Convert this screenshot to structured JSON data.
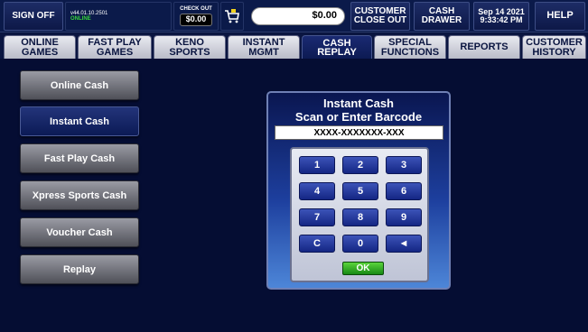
{
  "topbar": {
    "sign_off": "SIGN OFF",
    "version": "v44.01.10.2501",
    "status": "ONLINE",
    "checkout_label": "CHECK OUT",
    "checkout_amount": "$0.00",
    "balance": "$0.00",
    "customer_closeout": "CUSTOMER CLOSE OUT",
    "cash_drawer": "CASH DRAWER",
    "date": "Sep 14 2021",
    "time": "9:33:42 PM",
    "help": "HELP"
  },
  "tabs": [
    {
      "line1": "ONLINE",
      "line2": "GAMES"
    },
    {
      "line1": "FAST PLAY",
      "line2": "GAMES"
    },
    {
      "line1": "KENO",
      "line2": "SPORTS"
    },
    {
      "line1": "INSTANT",
      "line2": "MGMT"
    },
    {
      "line1": "CASH",
      "line2": "REPLAY"
    },
    {
      "line1": "SPECIAL",
      "line2": "FUNCTIONS"
    },
    {
      "line1": "REPORTS",
      "line2": ""
    },
    {
      "line1": "CUSTOMER",
      "line2": "HISTORY"
    }
  ],
  "sidebar": {
    "items": [
      {
        "label": "Online Cash"
      },
      {
        "label": "Instant Cash"
      },
      {
        "label": "Fast Play Cash"
      },
      {
        "label": "Xpress Sports Cash"
      },
      {
        "label": "Voucher Cash"
      },
      {
        "label": "Replay"
      }
    ]
  },
  "dialog": {
    "title_line1": "Instant Cash",
    "title_line2": "Scan or Enter Barcode",
    "barcode_placeholder": "XXXX-XXXXXXX-XXX",
    "keys": [
      "1",
      "2",
      "3",
      "4",
      "5",
      "6",
      "7",
      "8",
      "9",
      "C",
      "0",
      "◄"
    ],
    "ok_label": "OK"
  },
  "colors": {
    "background": "#0a1540",
    "active_tab": "#1a2a72",
    "ok_button": "#3aa82a",
    "online_status": "#37d43a"
  },
  "icons": {
    "cart": "shopping-cart-icon",
    "backspace": "backspace-arrow-icon"
  }
}
